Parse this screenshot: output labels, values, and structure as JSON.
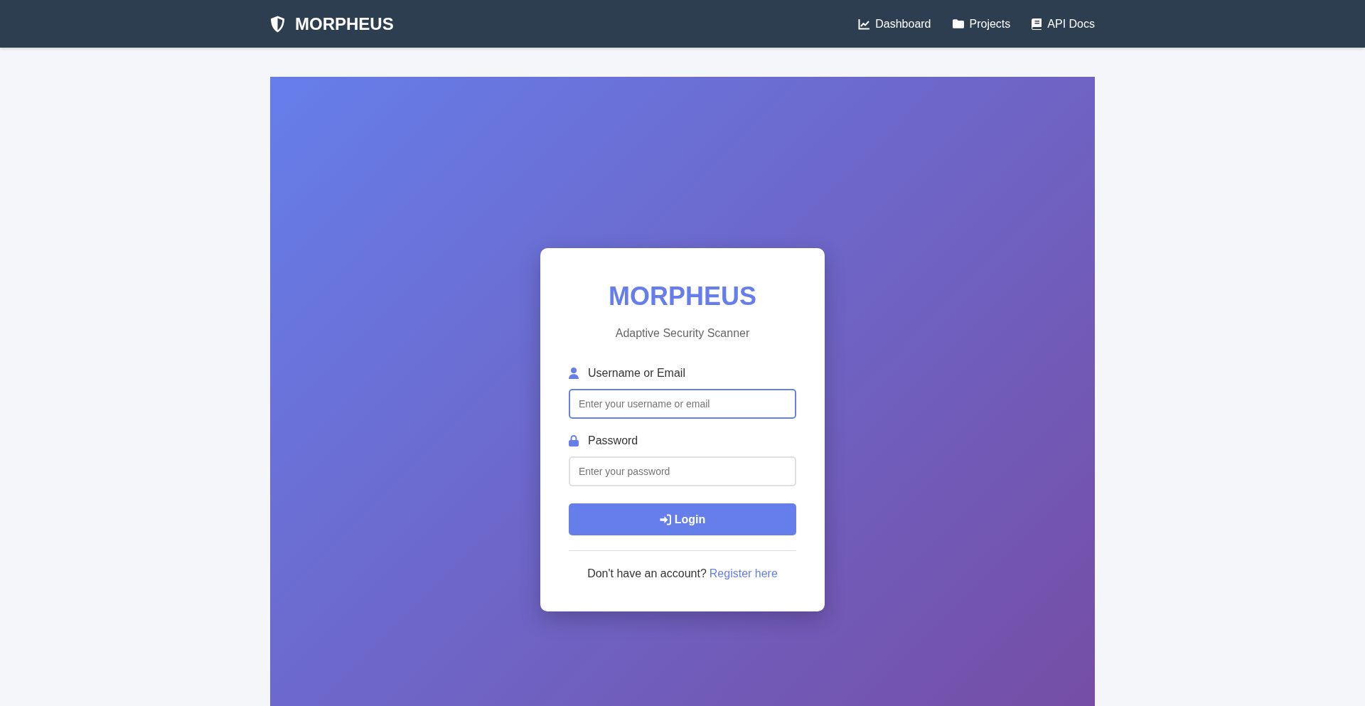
{
  "navbar": {
    "brand": "MORPHEUS",
    "links": [
      "Dashboard",
      "Projects",
      "API Docs"
    ]
  },
  "login_card": {
    "title": "MORPHEUS",
    "subtitle": "Adaptive Security Scanner",
    "fields": [
      {
        "label": "Username or Email",
        "placeholder": "Enter your username or email",
        "focused": true
      },
      {
        "label": "Password",
        "placeholder": "Enter your password",
        "focused": false
      }
    ],
    "submit_button": "Login",
    "footer": {
      "text": "Don't have an account?",
      "link": "Register here"
    }
  }
}
